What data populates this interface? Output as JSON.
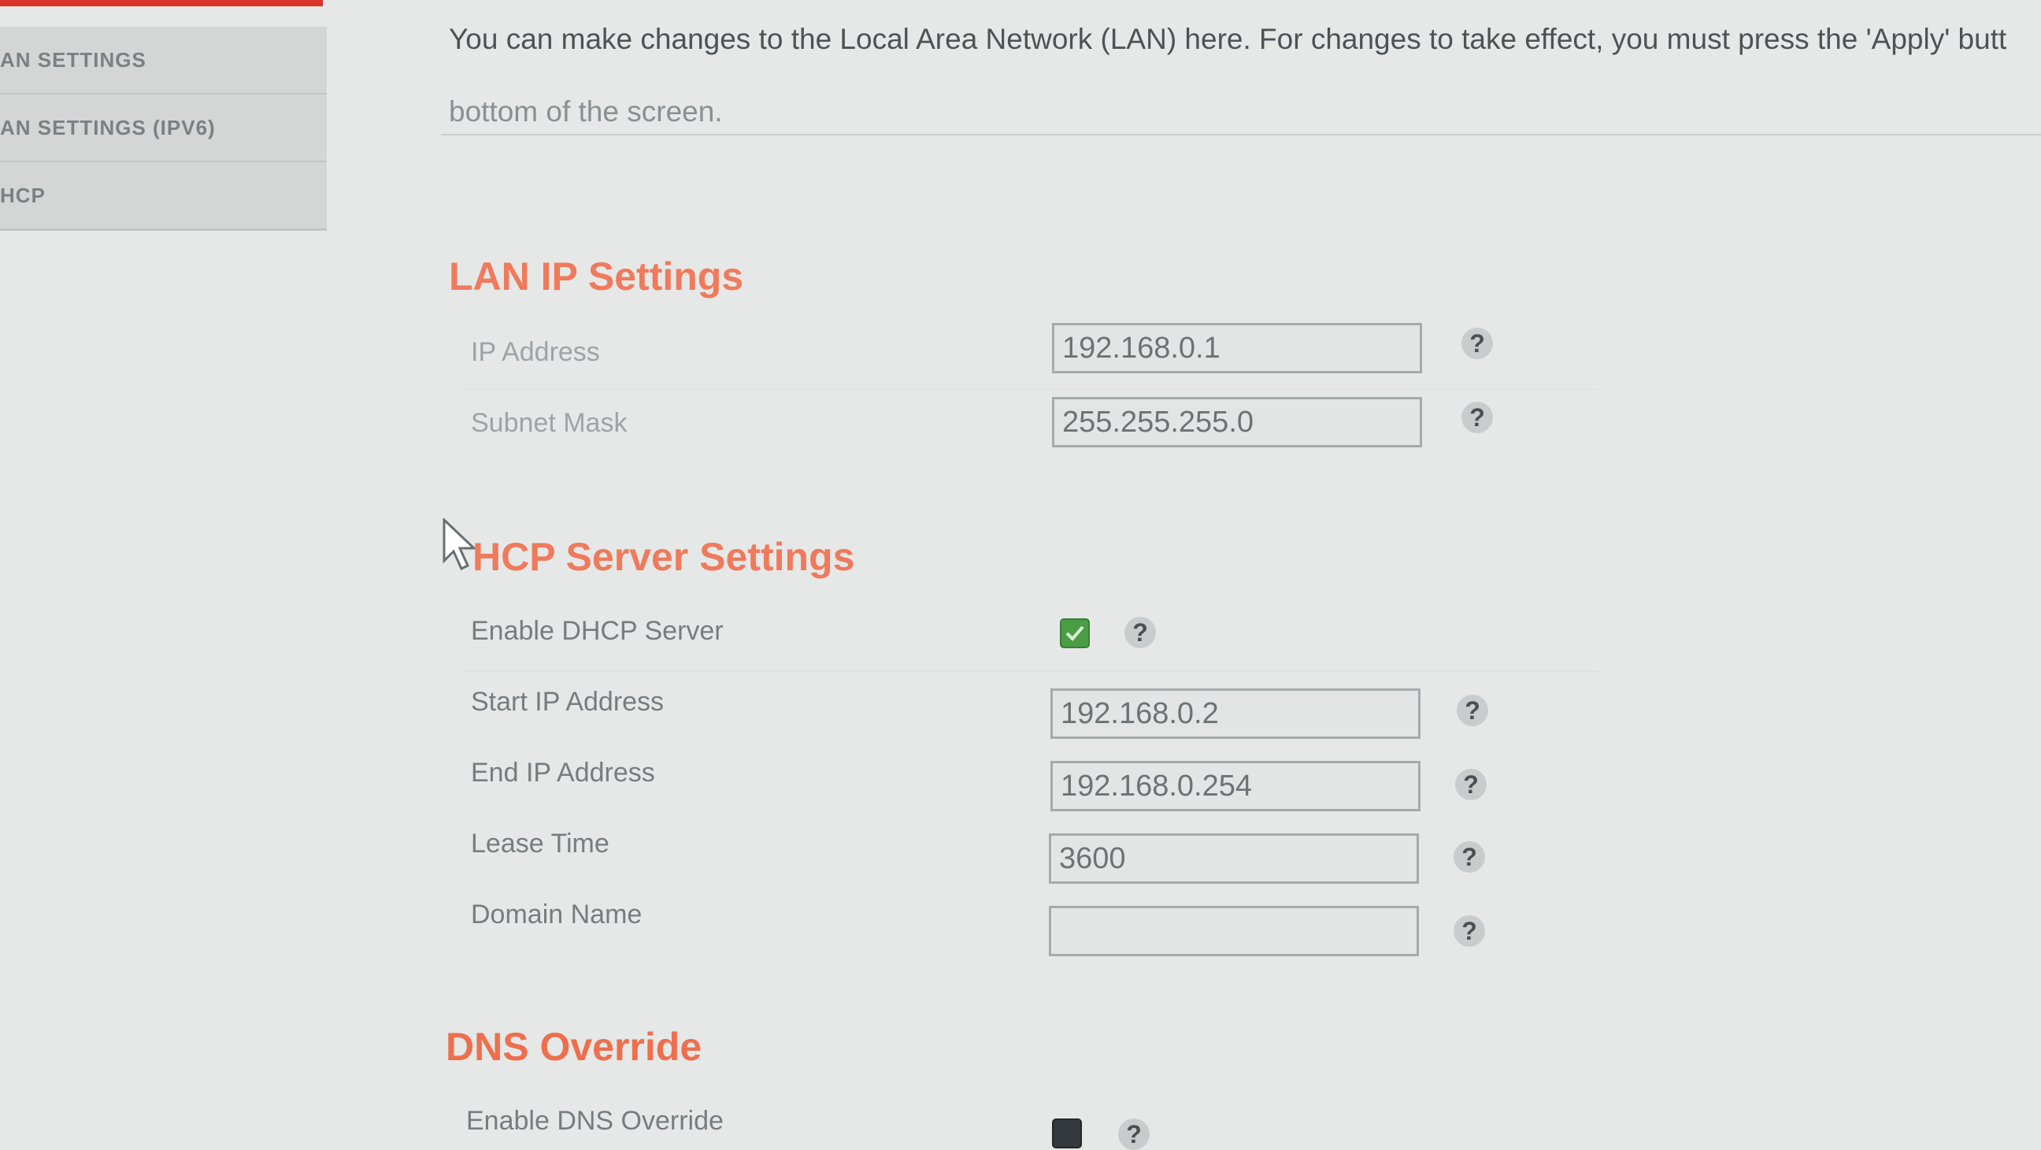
{
  "sidebar": {
    "items": [
      {
        "label": "AN SETTINGS"
      },
      {
        "label": "AN SETTINGS (IPV6)"
      },
      {
        "label": "HCP"
      }
    ]
  },
  "intro": {
    "line1": "You can make changes to the Local Area Network (LAN) here. For changes to take effect, you must press the 'Apply' butt",
    "line2": "bottom of the screen."
  },
  "lan_ip": {
    "title": "LAN IP Settings",
    "ip_label": "IP Address",
    "ip_value": "192.168.0.1",
    "mask_label": "Subnet Mask",
    "mask_value": "255.255.255.0"
  },
  "dhcp": {
    "title": "HCP Server Settings",
    "enable_label": "Enable DHCP Server",
    "enabled": true,
    "start_label": "Start IP Address",
    "start_value": "192.168.0.2",
    "end_label": "End IP Address",
    "end_value": "192.168.0.254",
    "lease_label": "Lease Time",
    "lease_value": "3600",
    "domain_label": "Domain Name",
    "domain_value": ""
  },
  "dns": {
    "title": "DNS Override",
    "enable_label": "Enable DNS Override",
    "enabled": false
  },
  "help_glyph": "?",
  "colors": {
    "accent": "#ef7a5c",
    "checkbox_on": "#4a9d44",
    "topbar": "#d8342a"
  }
}
